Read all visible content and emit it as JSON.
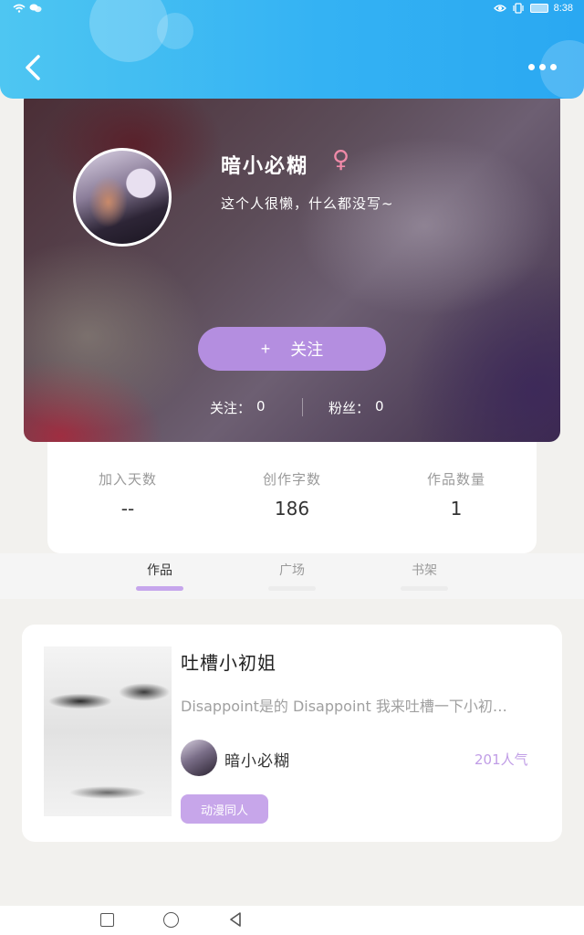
{
  "status_bar": {
    "time": "8:38"
  },
  "profile": {
    "nickname": "暗小必糊",
    "gender_symbol": "♀",
    "bio": "这个人很懒，什么都没写~",
    "follow_button": {
      "plus": "+",
      "label": "关注"
    },
    "following": {
      "label": "关注：",
      "value": "0"
    },
    "fans": {
      "label": "粉丝：",
      "value": "0"
    }
  },
  "stats": [
    {
      "label": "加入天数",
      "value": "--"
    },
    {
      "label": "创作字数",
      "value": "186"
    },
    {
      "label": "作品数量",
      "value": "1"
    }
  ],
  "tabs": [
    {
      "label": "作品",
      "active": true
    },
    {
      "label": "广场",
      "active": false
    },
    {
      "label": "书架",
      "active": false
    }
  ],
  "work": {
    "title": "吐槽小初姐",
    "description": "Disappoint是的 Disappoint 我来吐槽一下小初…",
    "author": "暗小必糊",
    "popularity": "201人气",
    "tag": "动漫同人"
  },
  "colors": {
    "header": "#34b2f3",
    "accent_purple": "#b48ee0",
    "gender_pink": "#f08aa8"
  }
}
